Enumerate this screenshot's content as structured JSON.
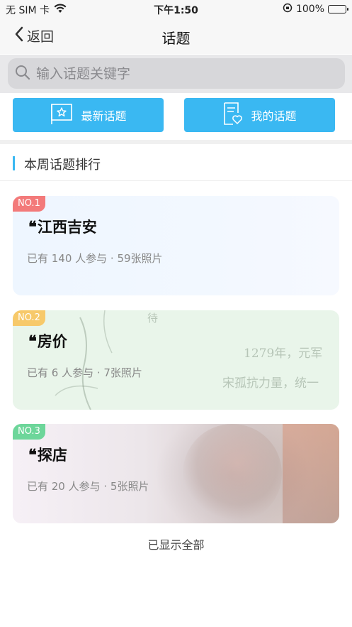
{
  "status_bar": {
    "carrier": "无 SIM 卡",
    "time": "下午1:50",
    "battery": "100%"
  },
  "nav": {
    "back_label": "返回",
    "title": "话题"
  },
  "search": {
    "placeholder": "输入话题关键字"
  },
  "actions": {
    "latest_label": "最新话题",
    "mine_label": "我的话题"
  },
  "section": {
    "title": "本周话题排行"
  },
  "topics": [
    {
      "rank": "NO.1",
      "quote": "❝",
      "name": "江西吉安",
      "stats": "已有 140 人参与 · 59张照片"
    },
    {
      "rank": "NO.2",
      "quote": "❝",
      "name": "房价",
      "stats": "已有 6 人参与 · 7张照片"
    },
    {
      "rank": "NO.3",
      "quote": "❝",
      "name": "探店",
      "stats": "已有 20 人参与 · 5张照片"
    }
  ],
  "card_bg_text": {
    "line1": "1279年，元军",
    "line2": "宋孤抗力量，统一",
    "char": "待"
  },
  "footer": {
    "end_text": "已显示全部"
  },
  "colors": {
    "accent": "#3ab8f2",
    "rank1": "#f37a7a",
    "rank2": "#f7c96a",
    "rank3": "#6dd69a"
  }
}
